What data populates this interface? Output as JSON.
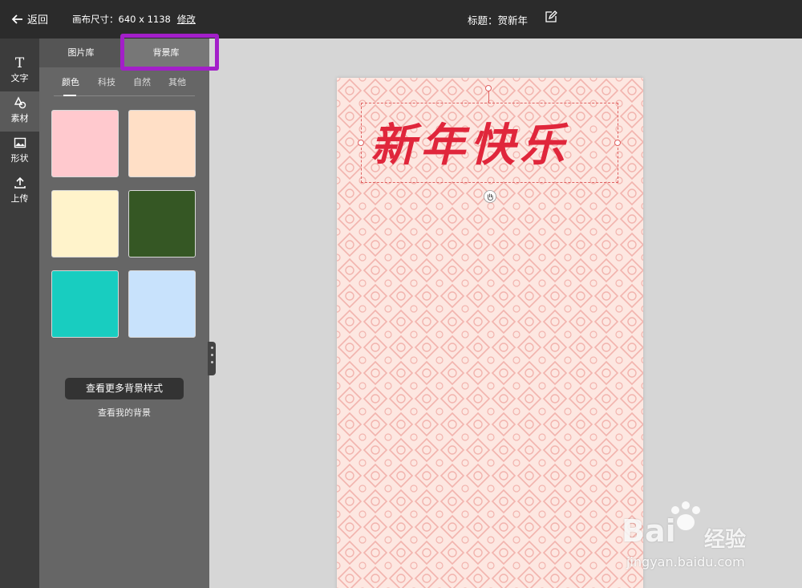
{
  "topbar": {
    "back_label": "返回",
    "canvas_size_label": "画布尺寸：640 x 1138",
    "edit_label": "修改",
    "title_label": "标题：贺新年"
  },
  "rail": {
    "items": [
      {
        "label": "文字",
        "icon": "text-icon"
      },
      {
        "label": "素材",
        "icon": "shapes-icon"
      },
      {
        "label": "形状",
        "icon": "image-icon"
      },
      {
        "label": "上传",
        "icon": "upload-icon"
      }
    ]
  },
  "panel": {
    "tabs": [
      {
        "label": "图片库"
      },
      {
        "label": "背景库"
      }
    ],
    "subtabs": [
      {
        "label": "颜色"
      },
      {
        "label": "科技"
      },
      {
        "label": "自然"
      },
      {
        "label": "其他"
      }
    ],
    "swatches": [
      "#ffc9ce",
      "#ffdfc6",
      "#fff3cb",
      "#355724",
      "#18cdc0",
      "#c8e2fc"
    ],
    "more_button": "查看更多背景样式",
    "my_bg_link": "查看我的背景"
  },
  "canvas": {
    "text": "新年快乐",
    "text_color": "#e0263b",
    "bg_color": "#fde7e1"
  },
  "watermark": {
    "brand": "Bai",
    "brand2": "经验",
    "url": "jingyan.baidu.com"
  }
}
